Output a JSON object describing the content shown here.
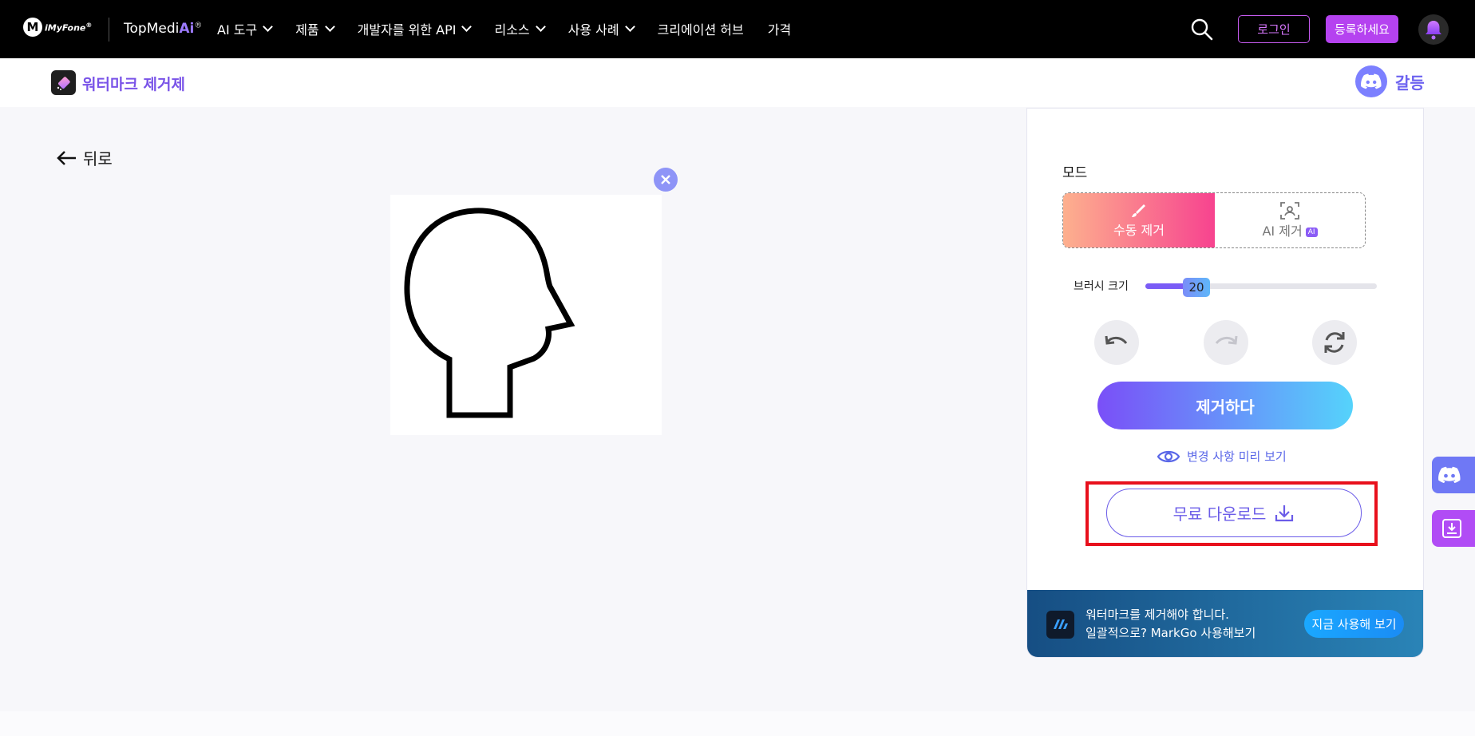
{
  "nav": {
    "brand": "iMyFone",
    "brand_reg": "®",
    "product_prefix": "TopMedi",
    "product_ai": "Ai",
    "product_reg": "®",
    "menu": [
      {
        "label": "AI 도구",
        "has_dropdown": true
      },
      {
        "label": "제품",
        "has_dropdown": true
      },
      {
        "label": "개발자를 위한 API",
        "has_dropdown": true
      },
      {
        "label": "리소스",
        "has_dropdown": true
      },
      {
        "label": "사용 사례",
        "has_dropdown": true
      },
      {
        "label": "크리에이션 허브",
        "has_dropdown": false
      },
      {
        "label": "가격",
        "has_dropdown": false
      }
    ],
    "login": "로그인",
    "signup": "등록하세요",
    "icons": [
      "search-icon",
      "bell-icon"
    ]
  },
  "subheader": {
    "title": "워터마크 제거제",
    "community": "갈등"
  },
  "main": {
    "back": "뒤로"
  },
  "panel": {
    "mode_label": "모드",
    "modes": {
      "manual": "수동 제거",
      "ai": "AI 제거",
      "ai_badge": "AI",
      "selected": "manual"
    },
    "brush_label": "브러시 크기",
    "brush_value": "20",
    "brush_fraction": 0.22,
    "remove": "제거하다",
    "preview": "변경 사항 미리 보기",
    "download": "무료 다운로드",
    "promo": {
      "line1": "워터마크를 제거해야 합니다.",
      "line2": "일괄적으로? MarkGo 사용해보기",
      "button": "지금 사용해 보기"
    }
  },
  "colors": {
    "accent": "#7a54e8",
    "highlight": "#e8101c",
    "signup": "#b542f0"
  }
}
